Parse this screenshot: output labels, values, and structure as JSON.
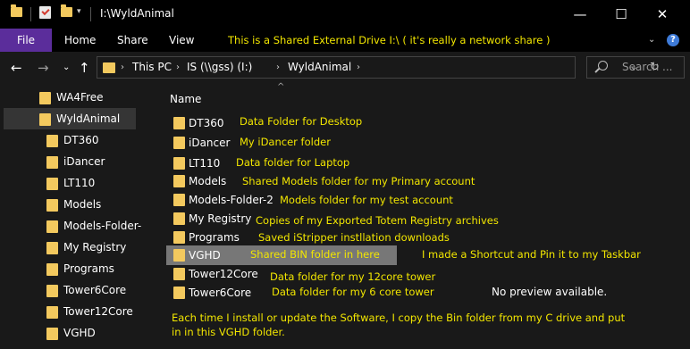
{
  "window": {
    "title": "I:\\WyldAnimal",
    "minimize_glyph": "—",
    "maximize_glyph": "☐",
    "close_glyph": "✕"
  },
  "ribbon": {
    "tabs": [
      "File",
      "Home",
      "Share",
      "View"
    ],
    "annotation": "This is a Shared External Drive I:\\  ( it's really a network share )",
    "help_glyph": "?",
    "chevron": "⌄"
  },
  "address": {
    "back": "←",
    "forward": "→",
    "recent": "⌄",
    "up": "↑",
    "breadcrumbs": [
      "This PC",
      "IS (\\\\gss) (I:)",
      "WyldAnimal"
    ],
    "separator": "›",
    "dropdown": "⌄",
    "refresh": "↻"
  },
  "search": {
    "placeholder": "Search ..."
  },
  "sidebar": {
    "items": [
      "WA4Free",
      "WyldAnimal",
      "DT360",
      "iDancer",
      "LT110",
      "Models",
      "Models-Folder-",
      "My Registry",
      "Programs",
      "Tower6Core",
      "Tower12Core",
      "VGHD"
    ]
  },
  "content": {
    "column_header": "Name",
    "sort_indicator": "^",
    "files": [
      {
        "name": "DT360",
        "note": "Data Folder for Desktop"
      },
      {
        "name": "iDancer",
        "note": "My iDancer folder"
      },
      {
        "name": "LT110",
        "note": "Data folder for Laptop"
      },
      {
        "name": "Models",
        "note": "Shared Models folder for my Primary account"
      },
      {
        "name": "Models-Folder-2",
        "note": "Models folder for my test account"
      },
      {
        "name": "My Registry",
        "note": "Copies of my Exported Totem Registry archives"
      },
      {
        "name": "Programs",
        "note": "Saved iStripper instllation downloads"
      },
      {
        "name": "VGHD",
        "note": "Shared BIN folder in here"
      },
      {
        "name": "Tower12Core",
        "note": "Data folder for my 12core tower"
      },
      {
        "name": "Tower6Core",
        "note": "Data folder for my 6 core tower"
      }
    ],
    "shortcut_note": "I made a Shortcut and Pin it to my Taskbar",
    "no_preview": "No preview available.",
    "bottom_note": "Each time I install or update the Software, I copy the Bin folder from my C drive and put in in this VGHD folder."
  },
  "colors": {
    "accent_file_tab": "#5b2d9b",
    "annotation": "#f2e600",
    "folder": "#f3c95e",
    "background": "#191919"
  }
}
